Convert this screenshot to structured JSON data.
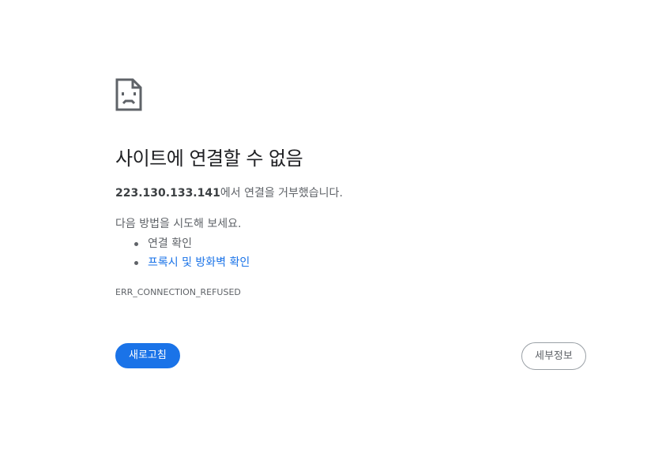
{
  "error": {
    "icon": "sad-page-icon",
    "title": "사이트에 연결할 수 없음",
    "host": "223.130.133.141",
    "message_suffix": "에서 연결을 거부했습니다.",
    "suggest_heading": "다음 방법을 시도해 보세요.",
    "suggestions": [
      {
        "label": "연결 확인",
        "link": false
      },
      {
        "label": "프록시 및 방화벽 확인",
        "link": true
      }
    ],
    "code": "ERR_CONNECTION_REFUSED"
  },
  "buttons": {
    "reload_label": "새로고침",
    "details_label": "세부정보"
  },
  "colors": {
    "accent": "#1a73e8",
    "text_primary": "#202124",
    "text_secondary": "#5f6368"
  }
}
